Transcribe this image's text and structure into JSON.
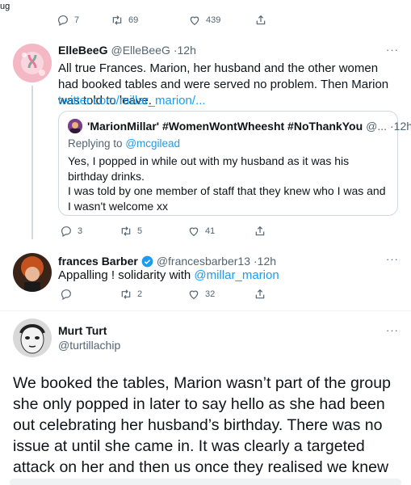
{
  "top_label": "ug",
  "tweet0": {
    "replies": "7",
    "retweets": "69",
    "likes": "439"
  },
  "tweet1": {
    "name": "ElleBeeG",
    "handle": "@ElleBeeG",
    "time": "·12h",
    "text": "All true Frances. Marion, her husband and the other women had booked tables and were served no problem. Then Marion was told to leave.",
    "link": "twitter.com/millar_marion/...",
    "replies": "3",
    "retweets": "5",
    "likes": "41",
    "quote": {
      "name": "'MarionMillar' #WomenWontWheesht #NoThankYou",
      "handle": "@...",
      "time": "·12h",
      "replying_label": "Replying to",
      "replying_handle": "@mcgilead",
      "line1": "Yes, I popped in while out with my husband as it was his birthday drinks.",
      "line2": "I was told by one member of staff that they knew who I was and I wasn't welcome xx"
    }
  },
  "tweet2": {
    "name": "frances Barber",
    "handle": "@francesbarber13",
    "time": "·12h",
    "text": "Appalling ! solidarity with",
    "mention": "@millar_marion",
    "retweets": "2",
    "likes": "32"
  },
  "tweet3": {
    "name": "Murt Turt",
    "handle": "@turtillachip",
    "text": "We booked the tables, Marion wasn’t part of the group she only popped in later to say hello as she had been out celebrating her husband’s birthday. There was no issue at until she came in. It was clearly a targeted attack on her and then us once they realised we knew her."
  },
  "more_glyph": "···",
  "colors": {
    "link": "#1d9bf0",
    "secondary": "#536471",
    "border": "#cfd9de",
    "verified": "#1d9bf0"
  }
}
